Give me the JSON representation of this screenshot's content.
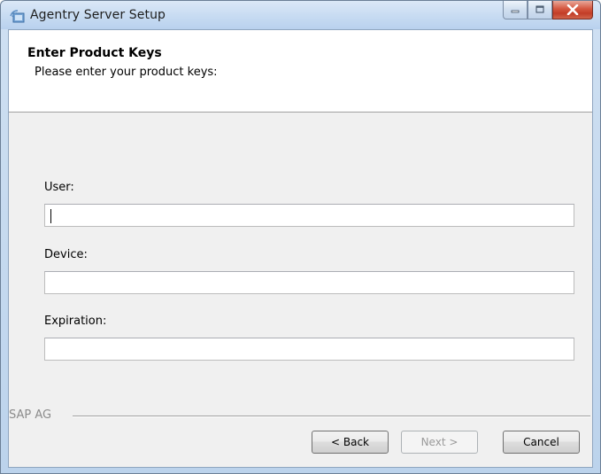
{
  "window": {
    "title": "Agentry Server Setup",
    "icon": "setup-app-icon",
    "controls": [
      "minimize-icon",
      "maximize-icon",
      "close-icon"
    ]
  },
  "header": {
    "title": "Enter Product Keys",
    "subtitle": "Please enter your product keys:"
  },
  "fields": {
    "user": {
      "label": "User:",
      "value": ""
    },
    "device": {
      "label": "Device:",
      "value": ""
    },
    "expiration": {
      "label": "Expiration:",
      "value": ""
    }
  },
  "footer": {
    "brand": "SAP AG",
    "back_label": "< Back",
    "next_label": "Next >",
    "cancel_label": "Cancel"
  },
  "colors": {
    "titlebar": "#c7dbf2",
    "close_button": "#c23d27",
    "client_bg": "#f0f0f0",
    "disabled_text": "#9a9a9a"
  }
}
